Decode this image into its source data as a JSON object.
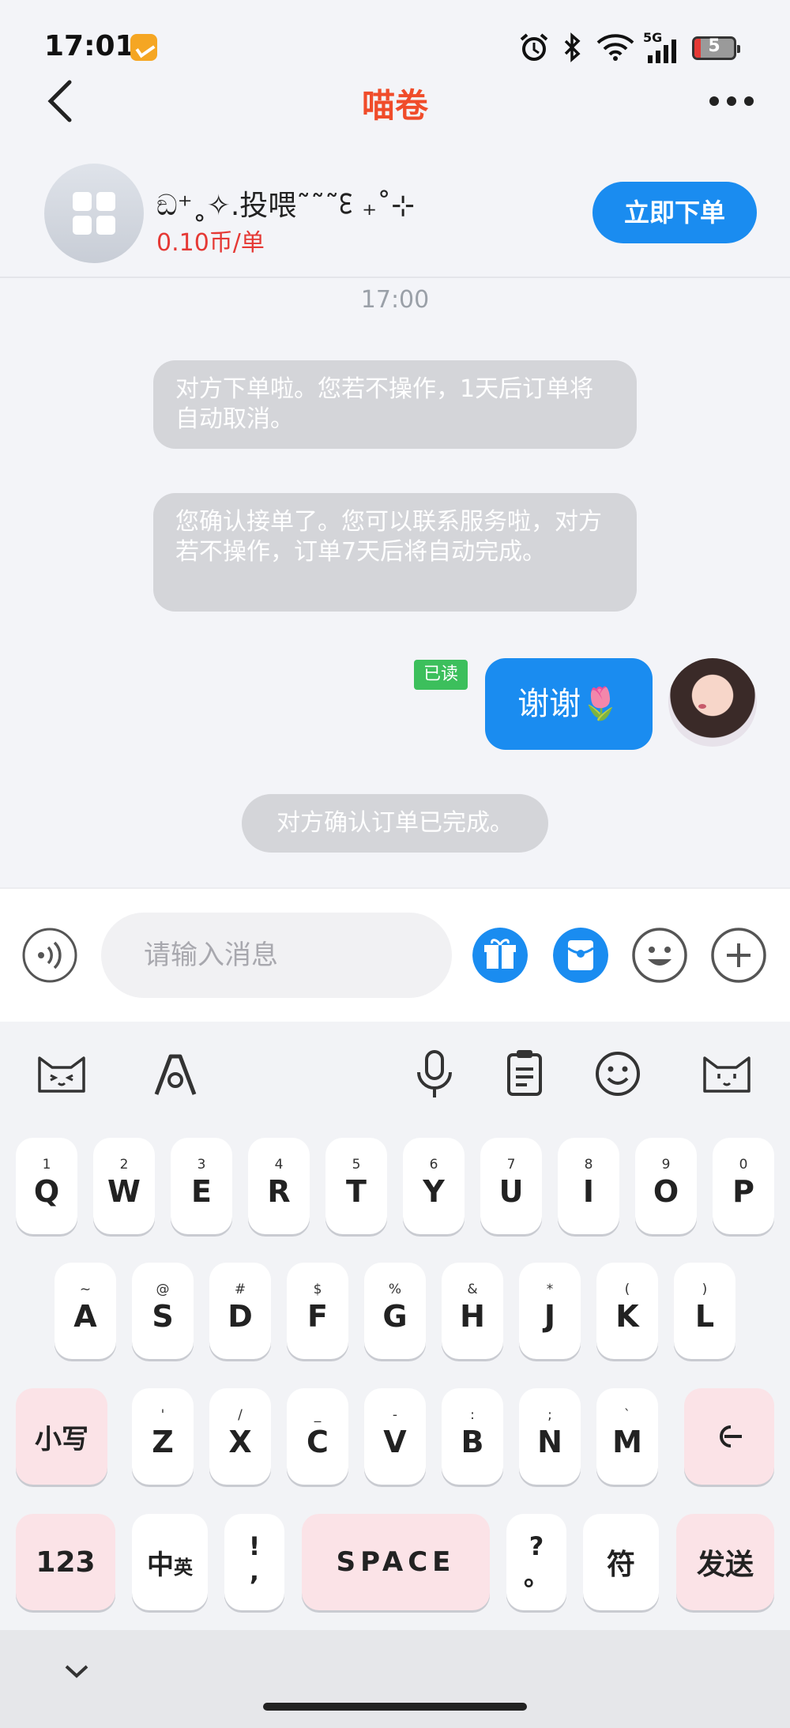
{
  "status_bar": {
    "time": "17:01",
    "network": "5G",
    "battery": "5"
  },
  "nav": {
    "title": "喵卷"
  },
  "product": {
    "name": "ඞ⁺˳✧.投喂˜˜˜ᢄ ₊˚⊹",
    "price": "0.10币/单",
    "order_button": "立即下单"
  },
  "chat": {
    "timestamp": "17:00",
    "system_messages": [
      "对方下单啦。您若不操作，1天后订单将自动取消。",
      "您确认接单了。您可以联系服务啦，对方若不操作，订单7天后将自动完成。"
    ],
    "my_message": {
      "text": "谢谢🌷",
      "read_label": "已读"
    },
    "final_system": "对方确认订单已完成。"
  },
  "input": {
    "placeholder": "请输入消息"
  },
  "keyboard": {
    "row1": [
      {
        "sup": "1",
        "key": "Q"
      },
      {
        "sup": "2",
        "key": "W"
      },
      {
        "sup": "3",
        "key": "E"
      },
      {
        "sup": "4",
        "key": "R"
      },
      {
        "sup": "5",
        "key": "T"
      },
      {
        "sup": "6",
        "key": "Y"
      },
      {
        "sup": "7",
        "key": "U"
      },
      {
        "sup": "8",
        "key": "I"
      },
      {
        "sup": "9",
        "key": "O"
      },
      {
        "sup": "0",
        "key": "P"
      }
    ],
    "row2": [
      {
        "sup": "~",
        "key": "A"
      },
      {
        "sup": "@",
        "key": "S"
      },
      {
        "sup": "#",
        "key": "D"
      },
      {
        "sup": "$",
        "key": "F"
      },
      {
        "sup": "%",
        "key": "G"
      },
      {
        "sup": "&",
        "key": "H"
      },
      {
        "sup": "*",
        "key": "J"
      },
      {
        "sup": "(",
        "key": "K"
      },
      {
        "sup": ")",
        "key": "L"
      }
    ],
    "row3": [
      {
        "sup": "'",
        "key": "Z"
      },
      {
        "sup": "/",
        "key": "X"
      },
      {
        "sup": "_",
        "key": "C"
      },
      {
        "sup": "-",
        "key": "V"
      },
      {
        "sup": ":",
        "key": "B"
      },
      {
        "sup": ";",
        "key": "N"
      },
      {
        "sup": "`",
        "key": "M"
      }
    ],
    "shift": "小写",
    "num": "123",
    "lang_main": "中",
    "lang_sub": "英",
    "punct_top": "!",
    "punct_bottom": ",",
    "space": "SPACE",
    "q_top": "?",
    "q_bottom": "。",
    "symbols": "符",
    "send": "发送"
  },
  "colors": {
    "accent": "#1a8cf0",
    "title": "#f04c2a",
    "price": "#e53935",
    "read": "#3cbf5c",
    "pink_key": "#fbe3e7"
  }
}
